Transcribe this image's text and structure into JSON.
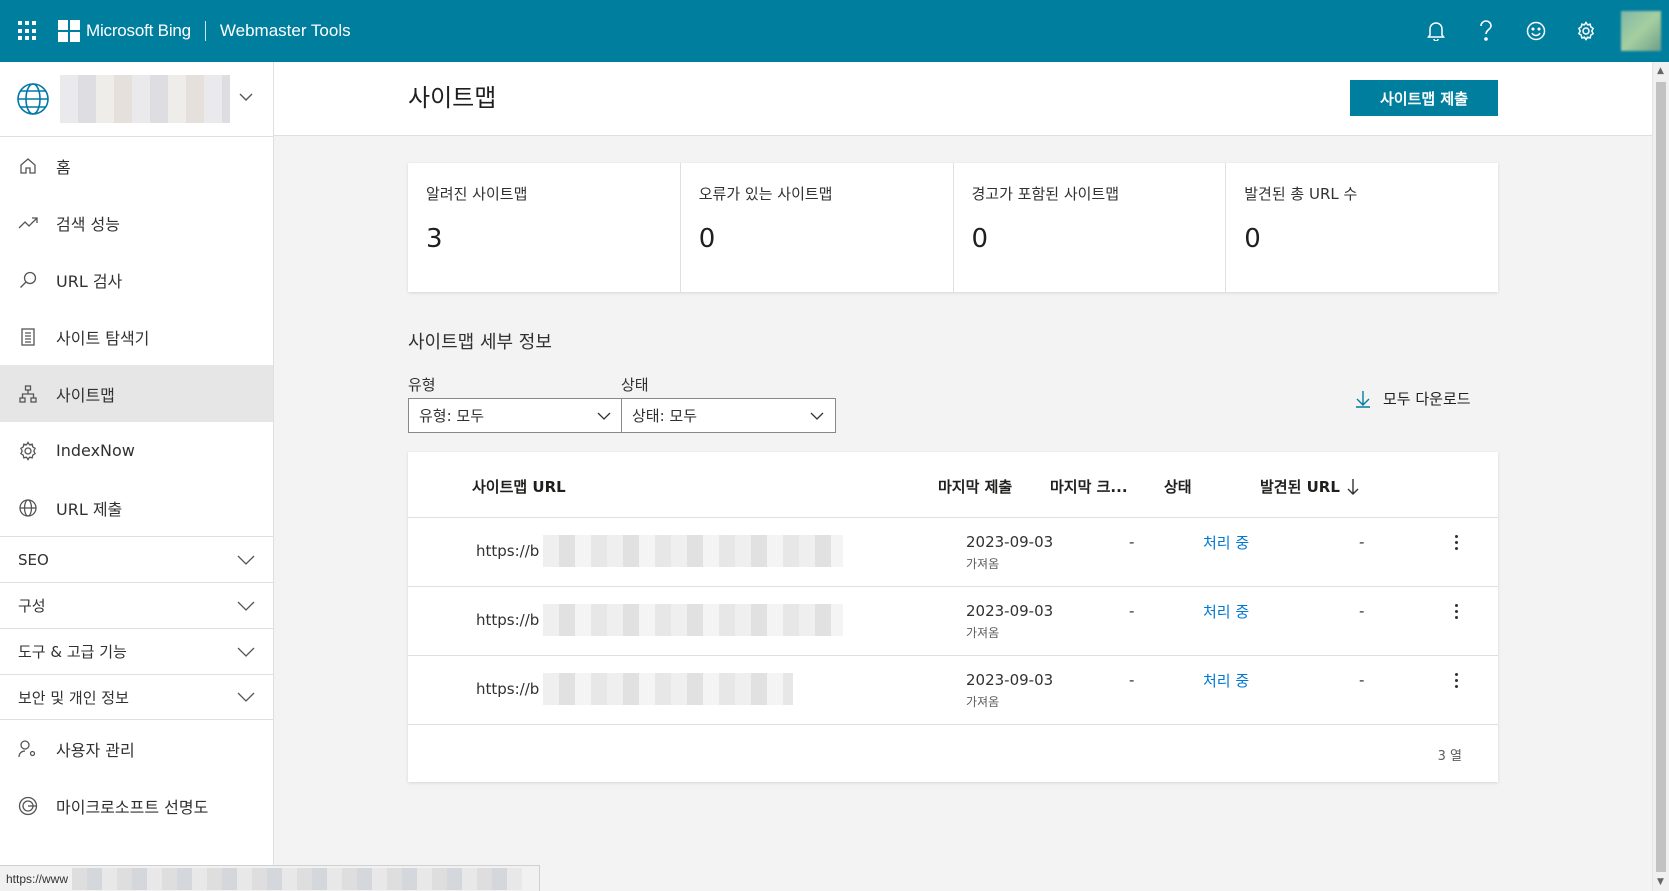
{
  "header": {
    "brand": "Microsoft Bing",
    "product": "Webmaster Tools",
    "icons": [
      "bell-icon",
      "help-icon",
      "smiley-feedback-icon",
      "gear-icon"
    ],
    "accent_color": "#007e9e"
  },
  "sidebar": {
    "nav_items": [
      {
        "label": "홈",
        "icon": "home-icon"
      },
      {
        "label": "검색 성능",
        "icon": "trend-icon"
      },
      {
        "label": "URL 검사",
        "icon": "search-icon"
      },
      {
        "label": "사이트 탐색기",
        "icon": "document-icon"
      },
      {
        "label": "사이트맵",
        "icon": "sitemap-icon",
        "active": true
      },
      {
        "label": "IndexNow",
        "icon": "gear-icon"
      },
      {
        "label": "URL 제출",
        "icon": "globe-icon"
      }
    ],
    "groups": [
      {
        "label": "SEO"
      },
      {
        "label": "구성"
      },
      {
        "label": "도구 & 고급 기능"
      },
      {
        "label": "보안 및 개인 정보"
      }
    ],
    "bottom_items": [
      {
        "label": "사용자 관리",
        "icon": "user-settings-icon"
      },
      {
        "label": "마이크로소프트 선명도",
        "icon": "clarity-icon"
      }
    ]
  },
  "page": {
    "title": "사이트맵",
    "submit_button": "사이트맵 제출"
  },
  "summary_cards": [
    {
      "label": "알려진 사이트맵",
      "value": "3"
    },
    {
      "label": "오류가 있는 사이트맵",
      "value": "0"
    },
    {
      "label": "경고가 포함된 사이트맵",
      "value": "0"
    },
    {
      "label": "발견된 총 URL 수",
      "value": "0"
    }
  ],
  "details": {
    "title": "사이트맵 세부 정보",
    "type_filter": {
      "label": "유형",
      "value": "유형: 모두"
    },
    "status_filter": {
      "label": "상태",
      "value": "상태: 모두"
    },
    "download_all": "모두 다운로드"
  },
  "table": {
    "headers": {
      "url": "사이트맵 URL",
      "last_submitted": "마지막 제출",
      "last_crawled": "마지막 크...",
      "status": "상태",
      "discovered_urls": "발견된 URL"
    },
    "rows": [
      {
        "url": "https://b",
        "date": "2023-09-03",
        "date_sub": "가져옴",
        "crawled": "-",
        "status": "처리 중",
        "discovered": "-"
      },
      {
        "url": "https://b",
        "date": "2023-09-03",
        "date_sub": "가져옴",
        "crawled": "-",
        "status": "처리 중",
        "discovered": "-"
      },
      {
        "url": "https://b",
        "date": "2023-09-03",
        "date_sub": "가져옴",
        "crawled": "-",
        "status": "처리 중",
        "discovered": "-"
      }
    ],
    "row_count": "3 열"
  },
  "statusbar": {
    "url_prefix": "https://www"
  }
}
